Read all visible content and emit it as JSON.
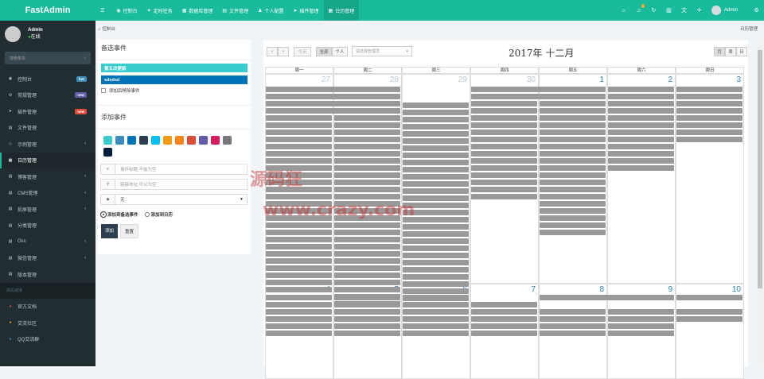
{
  "brand": "FastAdmin",
  "topnav": [
    {
      "icon": "☰",
      "label": ""
    },
    {
      "icon": "◉",
      "label": "控制台"
    },
    {
      "icon": "✦",
      "label": "定时任务"
    },
    {
      "icon": "▦",
      "label": "数据库管理"
    },
    {
      "icon": "▤",
      "label": "文件管理"
    },
    {
      "icon": "♟",
      "label": "个人配置"
    },
    {
      "icon": "➤",
      "label": "插件管理"
    },
    {
      "icon": "▦",
      "label": "日历管理"
    }
  ],
  "topright": {
    "badge": "1",
    "user": "Admin"
  },
  "sidebar": {
    "username": "Admin",
    "status": "在线",
    "search_placeholder": "搜索菜单",
    "items": [
      {
        "icon": "◉",
        "label": "控制台",
        "tag": "hot",
        "tagcolor": "#3c8dbc"
      },
      {
        "icon": "⚙",
        "label": "常规管理",
        "tag": "new",
        "tagcolor": "#605ca8"
      },
      {
        "icon": "➤",
        "label": "插件管理",
        "tag": "new",
        "tagcolor": "#dd4b39"
      },
      {
        "icon": "▤",
        "label": "文件管理"
      },
      {
        "icon": "◇",
        "label": "示例管理",
        "arrow": "‹"
      },
      {
        "icon": "▦",
        "label": "日历管理",
        "active": true
      },
      {
        "icon": "▤",
        "label": "博客管理",
        "arrow": "‹"
      },
      {
        "icon": "▤",
        "label": "CMS管理",
        "arrow": "‹"
      },
      {
        "icon": "▤",
        "label": "拆屏管理",
        "arrow": "‹"
      },
      {
        "icon": "▤",
        "label": "分类管理"
      },
      {
        "icon": "▤",
        "label": "Oss",
        "arrow": "‹"
      },
      {
        "icon": "▤",
        "label": "微信管理",
        "arrow": "‹"
      },
      {
        "icon": "▤",
        "label": "版本管理"
      }
    ],
    "header": "相关链接",
    "links": [
      {
        "icon": "●",
        "color": "#dd4b39",
        "label": "官方文档"
      },
      {
        "icon": "●",
        "color": "#f39c12",
        "label": "交流社区"
      },
      {
        "icon": "●",
        "color": "#3c8dbc",
        "label": "QQ交流群"
      }
    ]
  },
  "breadcrumb": {
    "home": "控制台",
    "right": "日历管理"
  },
  "left": {
    "title": "备选事件",
    "events": [
      {
        "label": "第五次更新",
        "color": "#39cccc"
      },
      {
        "label": "sdsdsd",
        "color": "#0073b7"
      }
    ],
    "remove_after": "添加后移除事件",
    "title2": "添加事件",
    "colors": [
      "#39cccc",
      "#3c8dbc",
      "#0073b7",
      "#2c3e50",
      "#00c0ef",
      "#f39c12",
      "#ff851b",
      "#dd4b39",
      "#605ca8",
      "#d81b60",
      "#777777",
      "#001f3f"
    ],
    "name_placeholder": "事件标题,不能为空",
    "link_placeholder": "链接地址,可以为空",
    "select_value": "无",
    "radio1": "添加到备选事件",
    "radio2": "添加到日历",
    "add_btn": "添加",
    "reset_btn": "重置"
  },
  "cal": {
    "today": "今天",
    "all": "全部",
    "personal": "个人",
    "select_placeholder": "请选择管理员",
    "title": "2017年 十二月",
    "views": [
      "月",
      "周",
      "日"
    ],
    "days": [
      "周一",
      "周二",
      "周三",
      "周四",
      "周五",
      "周六",
      "周日"
    ],
    "row1": [
      "27",
      "28",
      "29",
      "30",
      "1",
      "2",
      "3"
    ],
    "row2": [
      "4",
      "5",
      "6",
      "7",
      "8",
      "9",
      "10"
    ]
  },
  "watermark": "源码狂",
  "watermark2": "www.crazy.com"
}
